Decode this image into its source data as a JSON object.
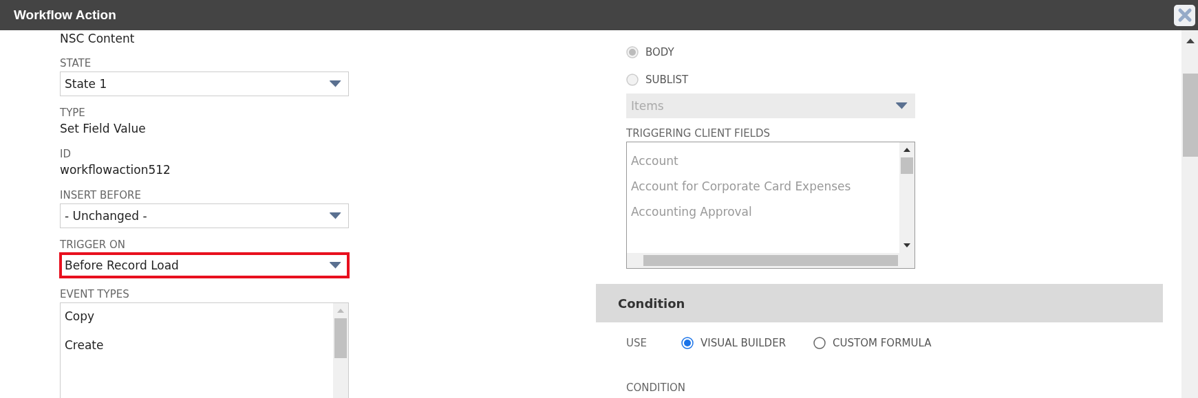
{
  "window": {
    "title": "Workflow Action"
  },
  "left": {
    "fields": [
      {
        "kind": "text",
        "value": "NSC Content"
      },
      {
        "kind": "select",
        "label": "STATE",
        "value": "State 1",
        "highlighted": false
      },
      {
        "kind": "text",
        "label": "TYPE",
        "value": "Set Field Value"
      },
      {
        "kind": "text",
        "label": "ID",
        "value": "workflowaction512"
      },
      {
        "kind": "select",
        "label": "INSERT BEFORE",
        "value": "- Unchanged -",
        "highlighted": false
      },
      {
        "kind": "select",
        "label": "TRIGGER ON",
        "value": "Before Record Load",
        "highlighted": true
      },
      {
        "kind": "listbox",
        "label": "EVENT TYPES",
        "items": [
          "Copy",
          "Create"
        ]
      }
    ]
  },
  "right": {
    "scope_options": [
      {
        "label": "BODY",
        "selected": true,
        "disabled": true
      },
      {
        "label": "SUBLIST",
        "selected": false,
        "disabled": true
      }
    ],
    "sublist_select": {
      "value": "Items",
      "disabled": true
    },
    "triggering_client_fields": {
      "label": "TRIGGERING CLIENT FIELDS",
      "disabled": true,
      "items": [
        "Account",
        "Account for Corporate Card Expenses",
        "Accounting Approval"
      ]
    },
    "condition": {
      "title": "Condition",
      "use_label": "USE",
      "options": [
        {
          "label": "VISUAL BUILDER",
          "selected": true
        },
        {
          "label": "CUSTOM FORMULA",
          "selected": false
        }
      ],
      "condition_label": "CONDITION"
    }
  }
}
